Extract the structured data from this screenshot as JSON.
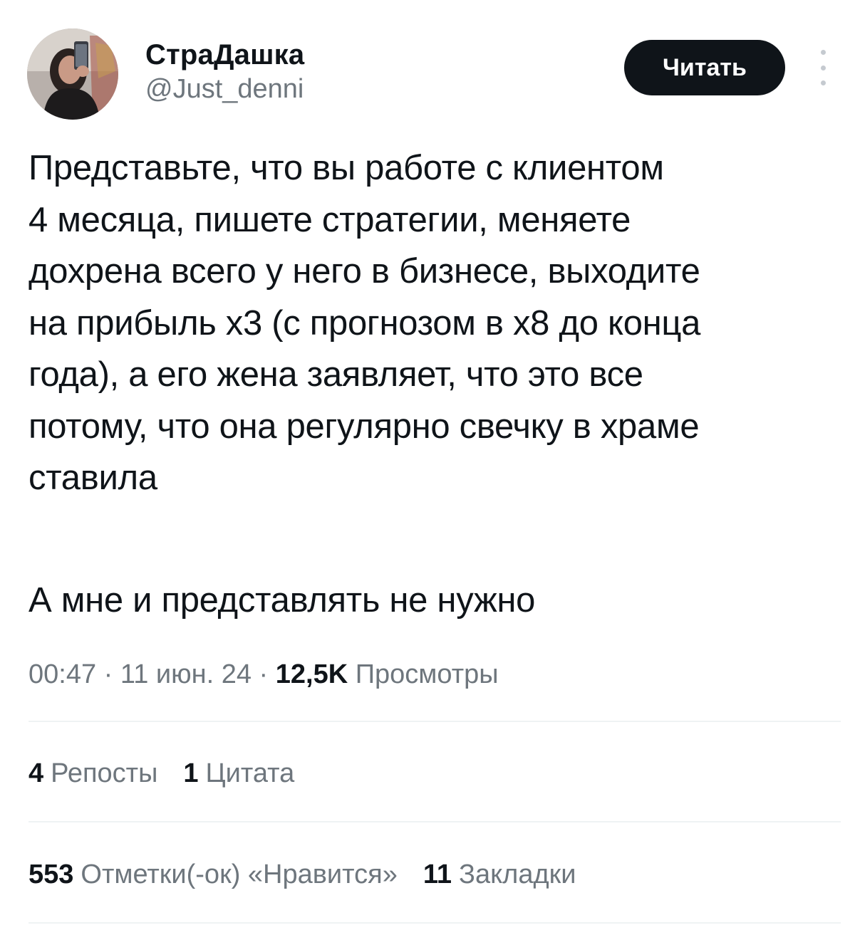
{
  "user": {
    "display_name": "СтраДашка",
    "handle": "@Just_denni",
    "avatar_icon": "user-avatar-photo"
  },
  "actions": {
    "follow_label": "Читать",
    "more_icon": "more-vertical-icon"
  },
  "tweet": {
    "text": "Представьте, что вы работе с клиентом\n4 месяца, пишете стратегии, меняете\nдохрена всего у него в бизнесе, выходите\nна прибыль х3 (с прогнозом в х8 до конца\nгода), а его жена заявляет, что это все\nпотому, что она регулярно свечку в храме\nставила",
    "text2": "А мне и представлять не нужно"
  },
  "meta": {
    "time": "00:47",
    "sep1": " · ",
    "date": "11 июн. 24",
    "sep2": " · ",
    "views_count": "12,5K",
    "views_label": " Просмотры"
  },
  "stats": {
    "reposts_count": "4",
    "reposts_label": "Репосты",
    "quotes_count": "1",
    "quotes_label": "Цитата",
    "likes_count": "553",
    "likes_label": "Отметки(-ок) «Нравится»",
    "bookmarks_count": "11",
    "bookmarks_label": "Закладки"
  },
  "colors": {
    "text_primary": "#0f1419",
    "text_secondary": "#6e767d",
    "button_bg": "#0f1419",
    "divider": "#eff3f4"
  }
}
